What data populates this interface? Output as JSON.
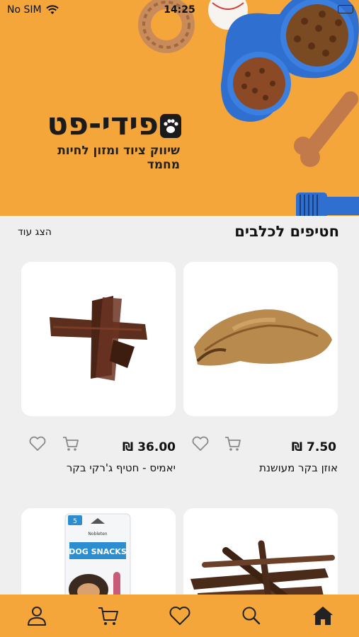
{
  "status_bar": {
    "carrier": "No SIM",
    "time": "14:25"
  },
  "banner": {
    "brand_name": "פידי-פט",
    "tagline": "שיווק ציוד ומזון לחיות מחמד"
  },
  "section": {
    "title": "חטיפים לכלבים",
    "show_more_label": "הצג עוד"
  },
  "products": [
    {
      "name": "אוזן בקר מעושנת",
      "price": "7.50 ₪"
    },
    {
      "name": "יאמיס - חטיף ג'רקי בקר",
      "price": "36.00 ₪"
    },
    {
      "name": "",
      "price": ""
    },
    {
      "name": "",
      "price": ""
    }
  ],
  "package_text": {
    "brand": "Nobleten",
    "title": "DOG SNACKS",
    "badge": "5"
  },
  "colors": {
    "accent": "#f4a63b",
    "background": "#efefef",
    "icon_gray": "#8a8a8a"
  },
  "icons": {
    "nav": [
      "home-icon",
      "search-icon",
      "heart-icon",
      "cart-icon",
      "user-icon"
    ]
  }
}
